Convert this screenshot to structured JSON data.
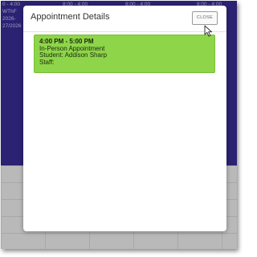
{
  "calendar": {
    "left_col": [
      "0 - 4:00",
      "WThF",
      "2026-",
      "27/2026"
    ],
    "time_labels": [
      "8:00 - 4:00",
      "8:00 - 4:00",
      "8:00 - 4:00"
    ]
  },
  "dialog": {
    "title": "Appointment Details",
    "close_label": "CLOSE",
    "appointment": {
      "time": "4:00 PM - 5:00 PM",
      "type": "In-Person Appointment",
      "student": "Student: Addison Sharp",
      "staff": "Staff:",
      "color": "#8ed54a"
    }
  },
  "colors": {
    "calendar_bg": "#2b2273",
    "overlay_gray": "#b4b4b4"
  },
  "icons": {
    "cursor": "mouse-pointer-icon"
  }
}
